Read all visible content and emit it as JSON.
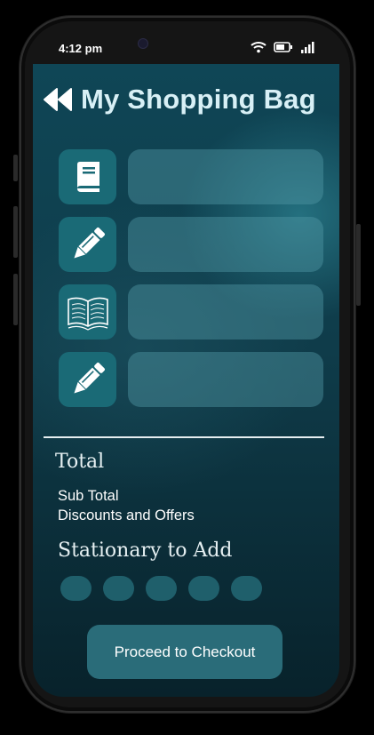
{
  "status_bar": {
    "time": "4:12 pm"
  },
  "header": {
    "title": "My Shopping Bag"
  },
  "items": [
    {
      "icon": "book-icon"
    },
    {
      "icon": "pencil-icon"
    },
    {
      "icon": "open-book-icon"
    },
    {
      "icon": "pencil-icon"
    }
  ],
  "totals": {
    "heading": "Total",
    "sub_total_label": "Sub Total",
    "discounts_label": "Discounts and Offers"
  },
  "stationary": {
    "heading": "Stationary to Add",
    "chip_count": 5
  },
  "checkout": {
    "label": "Proceed to Checkout"
  },
  "colors": {
    "accent": "#1a6a76",
    "card": "#5096a5",
    "button": "#2a6c79",
    "text_light": "#d8f0f6"
  }
}
